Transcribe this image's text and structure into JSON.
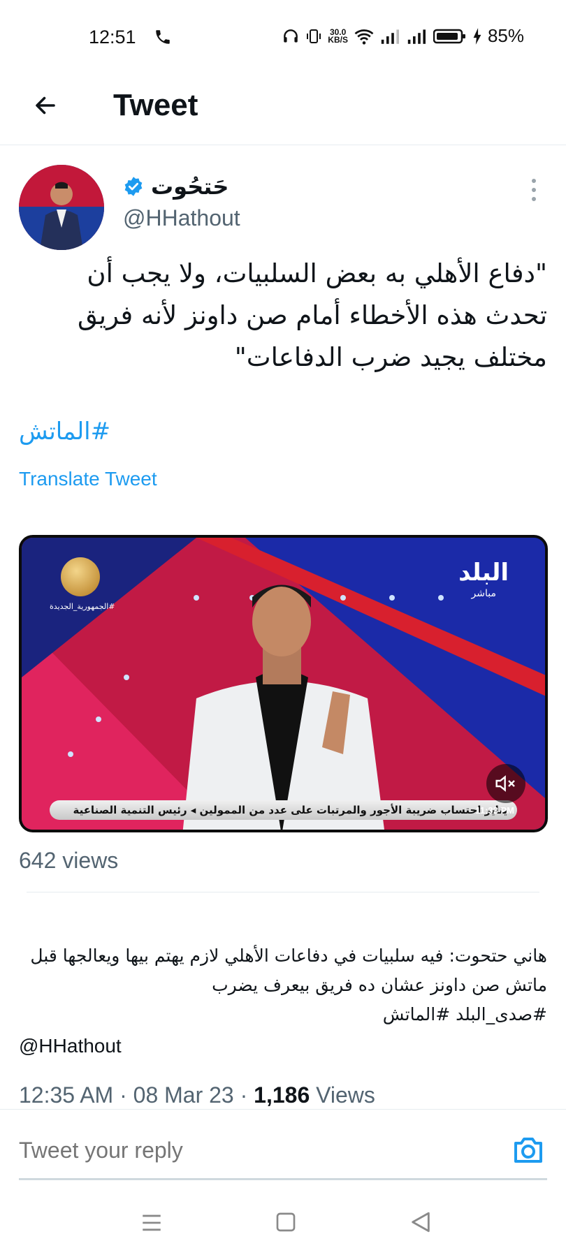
{
  "status_bar": {
    "time": "12:51",
    "net_speed_value": "30.0",
    "net_speed_unit": "KB/S",
    "battery": "85%"
  },
  "header": {
    "title": "Tweet"
  },
  "tweet": {
    "display_name": "حَتحُوت",
    "handle": "@HHathout",
    "text": "\"دفاع الأهلي به بعض السلبيات، ولا يجب أن تحدث هذه الأخطاء أمام صن داونز لأنه فريق مختلف يجيد ضرب الدفاعات\"",
    "hashtag": "#الماتش",
    "translate_label": "Translate Tweet",
    "media": {
      "channel_logo": "البلد",
      "channel_sub": "مباشر",
      "seal_caption": "#الجمهورية_الجديدة",
      "ticker": "يناير احتساب ضريبة الأجور والمرتبات على عدد من الممولين ◂ رئيس التنمية الصناعية",
      "ticker_time": "11:33 PM"
    },
    "media_views": "642 views",
    "quoted_text_line1": "هاني حتحوت: فيه سلبيات في دفاعات الأهلي لازم يهتم بيها ويعالجها قبل ماتش صن داونز عشان ده فريق بيعرف يضرب",
    "quoted_hashtags": "#صدى_البلد #الماتش",
    "mention": "@HHathout",
    "timestamp": "12:35 AM · 08 Mar 23 · ",
    "view_count": "1,186",
    "view_label": " Views"
  },
  "reply": {
    "placeholder": "Tweet your reply"
  },
  "colors": {
    "accent": "#1d9bf0",
    "secondary_text": "#536471"
  }
}
